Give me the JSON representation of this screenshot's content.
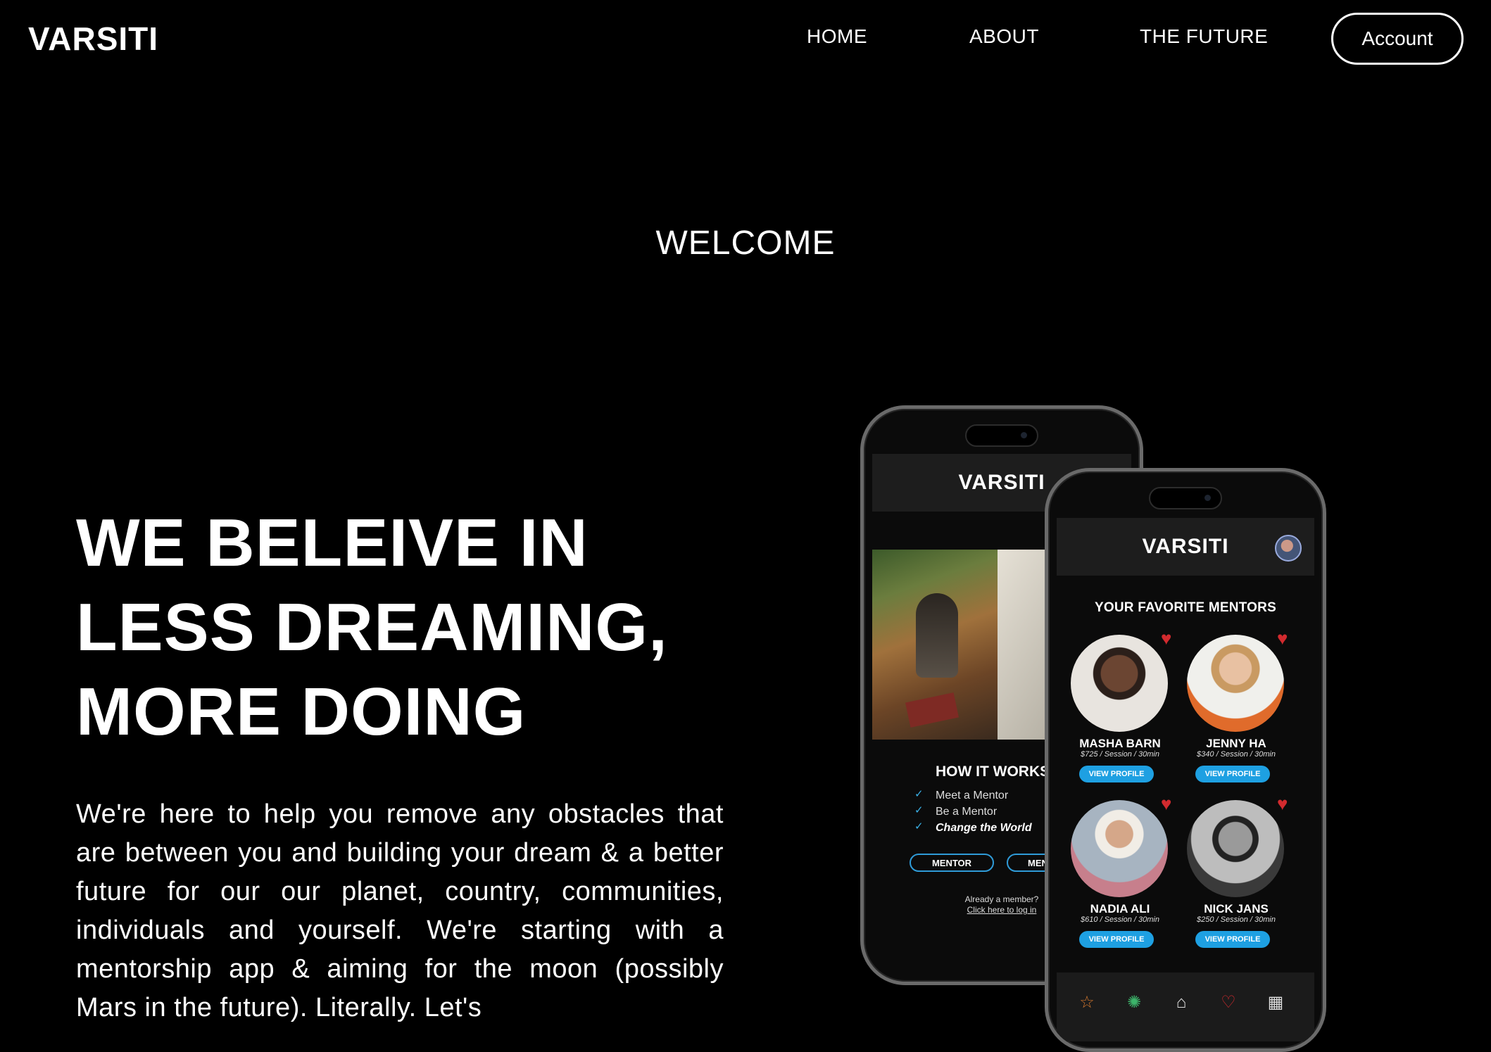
{
  "header": {
    "logo": "VARSITI",
    "nav": {
      "home": "HOME",
      "about": "ABOUT",
      "future": "THE FUTURE"
    },
    "account_label": "Account"
  },
  "hero": {
    "welcome": "WELCOME",
    "headline_lines": [
      "WE BELEIVE IN",
      "LESS DREAMING,",
      "MORE DOING"
    ],
    "body": "We're here to help you remove any obstacles that are between you and building your dream & a better future for our our planet, country, communities, individuals and yourself. We're starting with a mentorship app & aiming for the moon (possibly Mars in the future). Literally. Let's"
  },
  "phone_left": {
    "brand": "VARSITI",
    "how_title": "HOW IT WORKS",
    "how_items": [
      "Meet a Mentor",
      "Be a Mentor",
      "Change the World"
    ],
    "btn_mentor": "MENTOR",
    "btn_mentee": "MENTEE",
    "member_text": "Already a member?",
    "login_link": "Click here to log in"
  },
  "phone_right": {
    "brand": "VARSITI",
    "section_title": "YOUR FAVORITE MENTORS",
    "mentors": [
      {
        "name": "MASHA BARN",
        "price": "$725 / Session / 30min",
        "button": "VIEW PROFILE"
      },
      {
        "name": "JENNY HA",
        "price": "$340 / Session / 30min",
        "button": "VIEW PROFILE"
      },
      {
        "name": "NADIA ALI",
        "price": "$610 / Session / 30min",
        "button": "VIEW PROFILE"
      },
      {
        "name": "NICK JANS",
        "price": "$250 / Session / 30min",
        "button": "VIEW PROFILE"
      }
    ],
    "tab_icons": [
      "star-icon",
      "gear-icon",
      "home-icon",
      "heart-icon",
      "calendar-icon"
    ]
  },
  "colors": {
    "background": "#000000",
    "accent": "#1ea0e2",
    "heart": "#d22a2e"
  }
}
